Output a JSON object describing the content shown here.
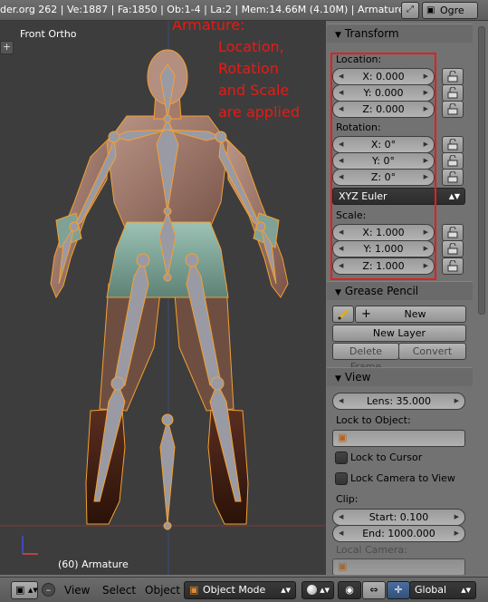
{
  "header": {
    "stats": "der.org 262 | Ve:1887 | Fa:1850 | Ob:1-4 | La:2 | Mem:14.66M (4.10M) | Armature",
    "scene": "Ogre"
  },
  "viewport": {
    "title": "Front Ortho",
    "object_label": "(60) Armature",
    "annotation": [
      "Armature:",
      "Location,",
      "Rotation",
      "and Scale",
      "are applied"
    ],
    "annotation_color": "#e81a14",
    "bone_color": "#9a9aa4",
    "selection_color": "#f5a030"
  },
  "transform": {
    "header": "Transform",
    "location_label": "Location:",
    "location": [
      "X: 0.000",
      "Y: 0.000",
      "Z: 0.000"
    ],
    "rotation_label": "Rotation:",
    "rotation": [
      "X: 0°",
      "Y: 0°",
      "Z: 0°"
    ],
    "rotation_mode": "XYZ Euler",
    "scale_label": "Scale:",
    "scale": [
      "X: 1.000",
      "Y: 1.000",
      "Z: 1.000"
    ]
  },
  "grease_pencil": {
    "header": "Grease Pencil",
    "new": "New",
    "new_layer": "New Layer",
    "delete_frame": "Delete Frame",
    "convert": "Convert"
  },
  "view": {
    "header": "View",
    "lens": "Lens: 35.000",
    "lock_to_object": "Lock to Object:",
    "lock_to_cursor": "Lock to Cursor",
    "lock_camera": "Lock Camera to View",
    "clip_label": "Clip:",
    "clip_start": "Start: 0.100",
    "clip_end": "End: 1000.000",
    "local_camera": "Local Camera:"
  },
  "footer": {
    "menu": [
      "View",
      "Select",
      "Object"
    ],
    "mode": "Object Mode",
    "orientation": "Global"
  }
}
